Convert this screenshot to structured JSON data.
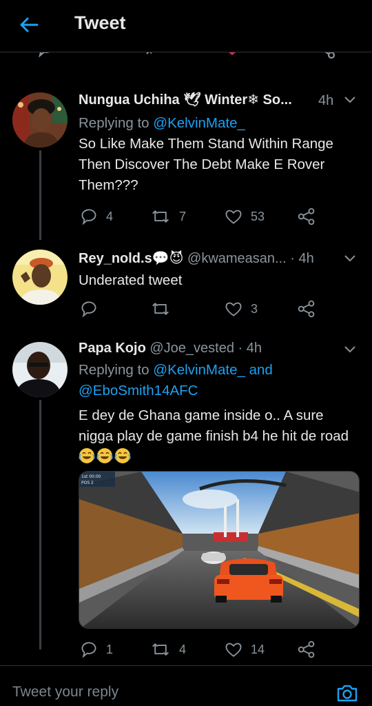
{
  "header": {
    "title": "Tweet"
  },
  "tweets": [
    {
      "display_name": "Nungua Uchiha 🕊 Winter❄ So...",
      "time": "4h",
      "replying_prefix": "Replying to ",
      "replying_to": "@KelvinMate_",
      "text": "So Like Make Them Stand Within Range Then Discover The Debt Make E Rover Them???",
      "replies": "4",
      "retweets": "7",
      "likes": "53"
    },
    {
      "display_name": "Rey_nold.s💬😈",
      "handle": "@kwameasan...",
      "time": "· 4h",
      "text": "Underated tweet",
      "replies": "",
      "retweets": "",
      "likes": "3"
    },
    {
      "display_name": "Papa Kojo",
      "handle": "@Joe_vested",
      "time": "· 4h",
      "replying_prefix": "Replying to ",
      "replying_to": "@KelvinMate_ and",
      "replying_to_2": "@EboSmith14AFC",
      "text": "E dey de Ghana game inside o.. A sure nigga play de game finish b4 he hit de road",
      "replies": "1",
      "retweets": "4",
      "likes": "14",
      "media": {
        "hud_line1": "1st 00:00",
        "hud_line2": "POS 2"
      }
    }
  ],
  "reply_bar": {
    "placeholder": "Tweet your reply"
  },
  "colors": {
    "accent": "#1da1f2",
    "like": "#e0245e",
    "muted": "#8a949c",
    "background": "#000000"
  }
}
